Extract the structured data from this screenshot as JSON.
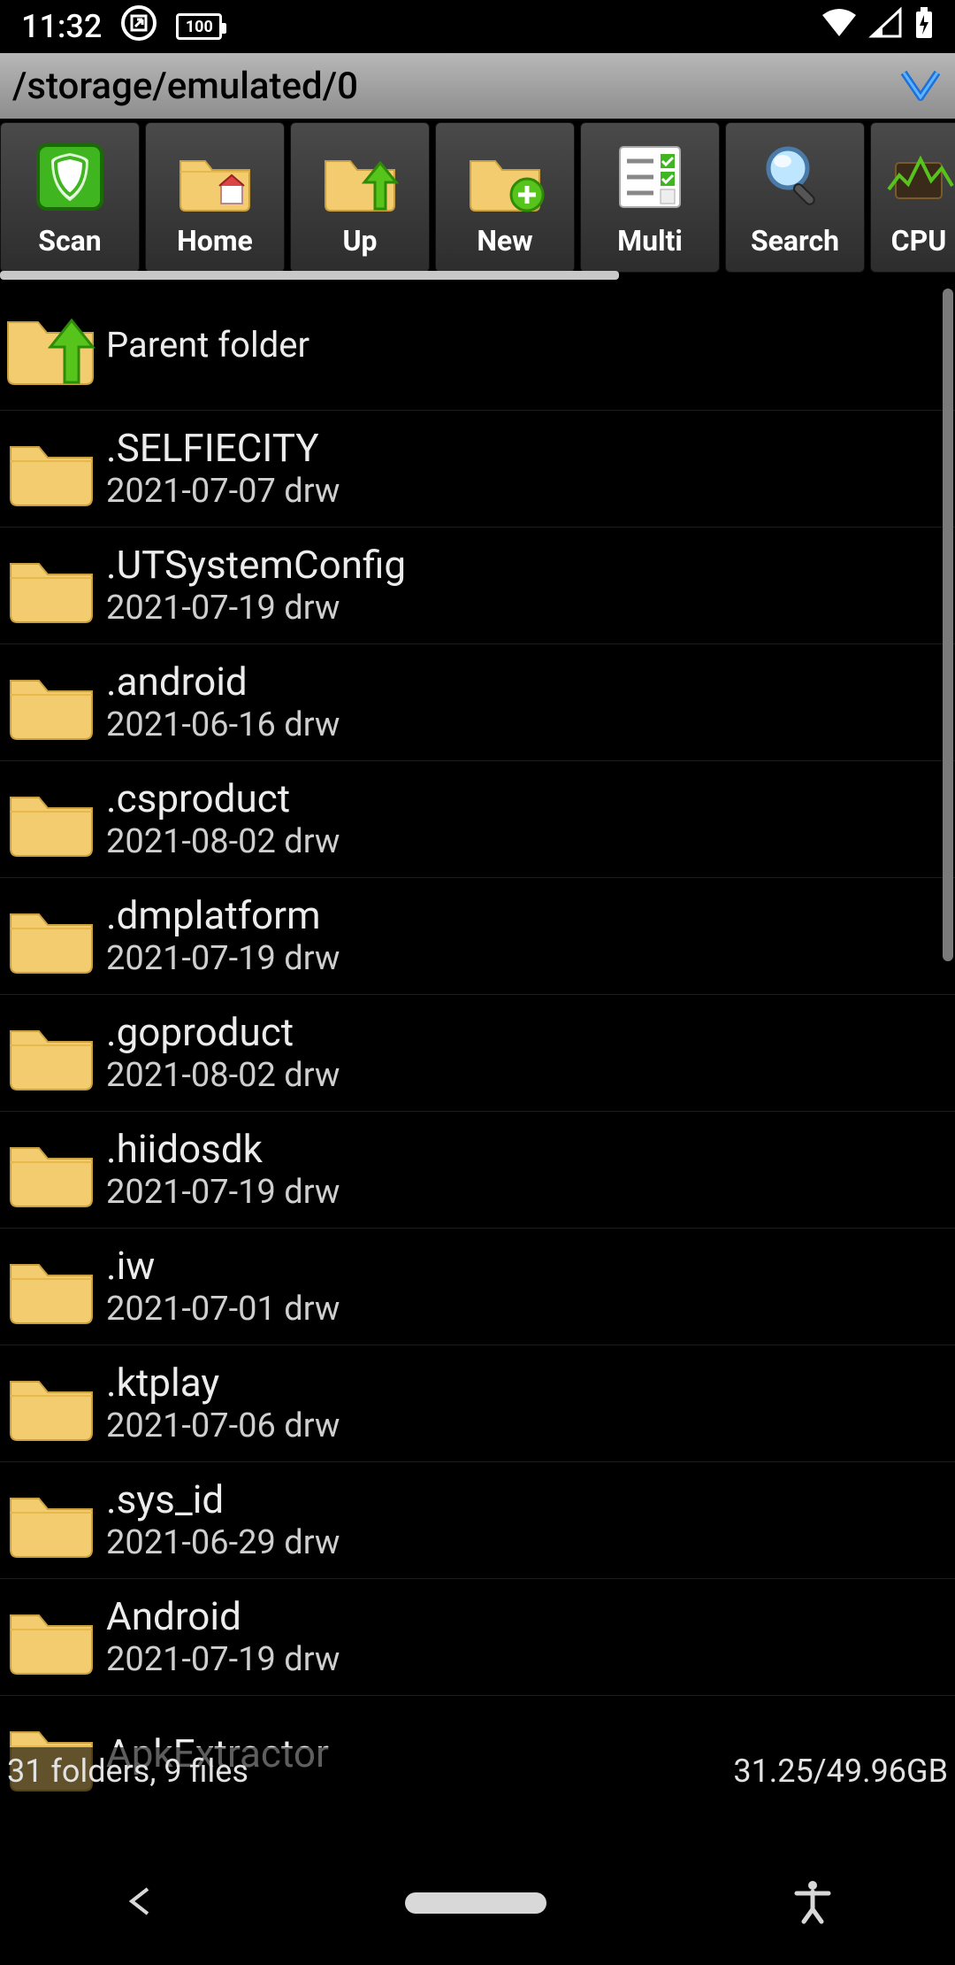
{
  "status": {
    "time": "11:32",
    "battery_text": "100"
  },
  "path": "/storage/emulated/0",
  "toolbar": [
    {
      "id": "scan",
      "label": "Scan"
    },
    {
      "id": "home",
      "label": "Home"
    },
    {
      "id": "up",
      "label": "Up"
    },
    {
      "id": "new",
      "label": "New"
    },
    {
      "id": "multi",
      "label": "Multi"
    },
    {
      "id": "search",
      "label": "Search"
    },
    {
      "id": "cpu",
      "label": "CPU"
    }
  ],
  "parent_label": "Parent folder",
  "files": [
    {
      "name": ".SELFIECITY",
      "meta": "2021-07-07 drw"
    },
    {
      "name": ".UTSystemConfig",
      "meta": "2021-07-19 drw"
    },
    {
      "name": ".android",
      "meta": "2021-06-16 drw"
    },
    {
      "name": ".csproduct",
      "meta": "2021-08-02 drw"
    },
    {
      "name": ".dmplatform",
      "meta": "2021-07-19 drw"
    },
    {
      "name": ".goproduct",
      "meta": "2021-08-02 drw"
    },
    {
      "name": ".hiidosdk",
      "meta": "2021-07-19 drw"
    },
    {
      "name": ".iw",
      "meta": "2021-07-01 drw"
    },
    {
      "name": ".ktplay",
      "meta": "2021-07-06 drw"
    },
    {
      "name": ".sys_id",
      "meta": "2021-06-29 drw"
    },
    {
      "name": "Android",
      "meta": "2021-07-19 drw"
    },
    {
      "name": "ApkExtractor",
      "meta": ""
    }
  ],
  "footer": {
    "left": "31 folders, 9 files",
    "right": "31.25/49.96GB"
  }
}
